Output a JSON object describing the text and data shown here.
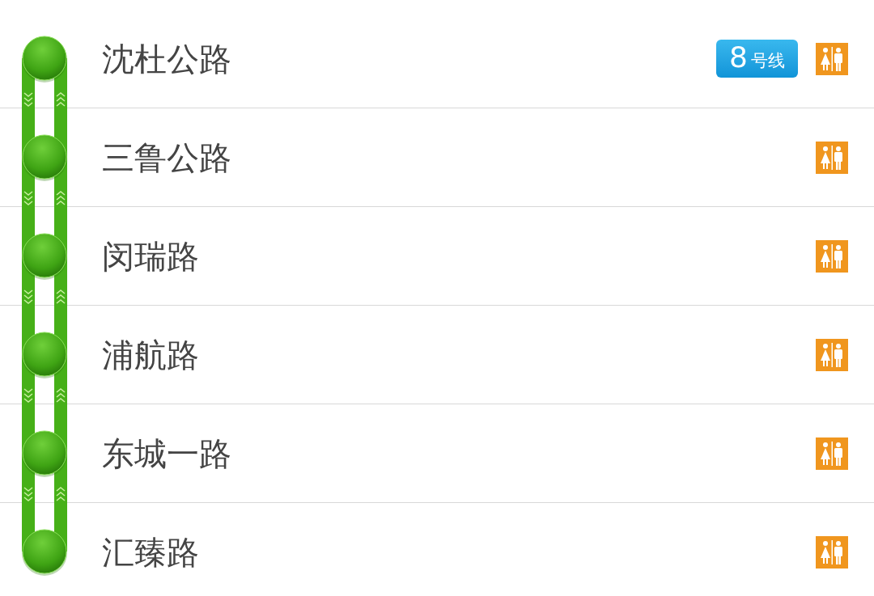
{
  "stations": [
    {
      "name": "沈杜公路",
      "transfer": {
        "number": "8",
        "label": "号线"
      },
      "restroom": true
    },
    {
      "name": "三鲁公路",
      "restroom": true
    },
    {
      "name": "闵瑞路",
      "restroom": true
    },
    {
      "name": "浦航路",
      "restroom": true
    },
    {
      "name": "东城一路",
      "restroom": true
    },
    {
      "name": "汇臻路",
      "restroom": true
    }
  ]
}
